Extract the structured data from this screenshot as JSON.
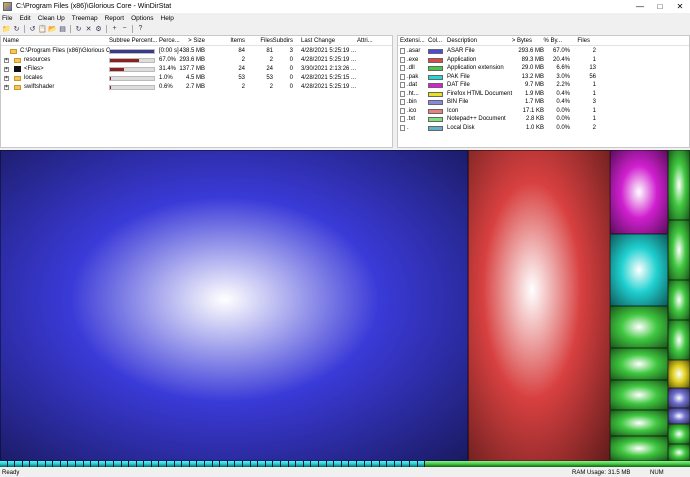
{
  "window": {
    "title": "C:\\Program Files (x86)\\Glorious Core - WinDirStat"
  },
  "menu": [
    "File",
    "Edit",
    "Clean Up",
    "Treemap",
    "Report",
    "Options",
    "Help"
  ],
  "toolbar": [
    "open-folder-icon",
    "refresh-icon",
    "refresh-all-icon",
    "copy-path-icon",
    "open-explorer-icon",
    "open-prompt-icon",
    "refresh-selected-icon",
    "delete-icon",
    "properties-icon",
    "zoom-in-icon",
    "zoom-out-icon",
    "help-icon"
  ],
  "tree": {
    "columns": [
      "Name",
      "Subtree Percent...",
      "Perce...",
      "> Size",
      "Items",
      "Files",
      "Subdirs",
      "Last Change",
      "Attri..."
    ],
    "rows": [
      {
        "name": "C:\\Program Files (x86)\\Glorious C...",
        "kind": "folder",
        "expander": "",
        "subtree_fraction": 1.0,
        "bar_color": "#3a3a8a",
        "percent": "[0:00 s]",
        "size": "438.5 MB",
        "items": "84",
        "files": "81",
        "subdirs": "3",
        "last_change": "4/28/2021 5:25:19 ...",
        "attrib": ""
      },
      {
        "name": "resources",
        "kind": "folder",
        "expander": "+",
        "subtree_fraction": 0.67,
        "bar_color": "#8b2020",
        "percent": "67.0%",
        "size": "293.6 MB",
        "items": "2",
        "files": "2",
        "subdirs": "0",
        "last_change": "4/28/2021 5:25:19 ...",
        "attrib": ""
      },
      {
        "name": "<Files>",
        "kind": "files",
        "expander": "+",
        "subtree_fraction": 0.314,
        "bar_color": "#8b2020",
        "percent": "31.4%",
        "size": "137.7 MB",
        "items": "24",
        "files": "24",
        "subdirs": "0",
        "last_change": "3/30/2021 2:13:26 ...",
        "attrib": ""
      },
      {
        "name": "locales",
        "kind": "folder",
        "expander": "+",
        "subtree_fraction": 0.01,
        "bar_color": "#8b2020",
        "percent": "1.0%",
        "size": "4.5 MB",
        "items": "53",
        "files": "53",
        "subdirs": "0",
        "last_change": "4/28/2021 5:25:15 ...",
        "attrib": ""
      },
      {
        "name": "swiftshader",
        "kind": "folder",
        "expander": "+",
        "subtree_fraction": 0.006,
        "bar_color": "#8b2020",
        "percent": "0.6%",
        "size": "2.7 MB",
        "items": "2",
        "files": "2",
        "subdirs": "0",
        "last_change": "4/28/2021 5:25:19 ...",
        "attrib": ""
      }
    ]
  },
  "extensions": {
    "columns": [
      "Extensi...",
      "Col...",
      "Description",
      "> Bytes",
      "% By...",
      "Files"
    ],
    "rows": [
      {
        "ext": ".asar",
        "color": "#4a4adc",
        "description": "ASAR File",
        "bytes": "293.6 MB",
        "percent": "67.0%",
        "files": "2"
      },
      {
        "ext": ".exe",
        "color": "#e04848",
        "description": "Application",
        "bytes": "89.3 MB",
        "percent": "20.4%",
        "files": "1"
      },
      {
        "ext": ".dll",
        "color": "#48c848",
        "description": "Application extension",
        "bytes": "29.0 MB",
        "percent": "6.6%",
        "files": "13"
      },
      {
        "ext": ".pak",
        "color": "#20d8d8",
        "description": "PAK File",
        "bytes": "13.2 MB",
        "percent": "3.0%",
        "files": "56"
      },
      {
        "ext": ".dat",
        "color": "#d820d8",
        "description": "DAT File",
        "bytes": "9.7 MB",
        "percent": "2.2%",
        "files": "1"
      },
      {
        "ext": ".ht...",
        "color": "#e8e020",
        "description": "Firefox HTML Document",
        "bytes": "1.9 MB",
        "percent": "0.4%",
        "files": "1"
      },
      {
        "ext": ".bin",
        "color": "#8888e0",
        "description": "BIN File",
        "bytes": "1.7 MB",
        "percent": "0.4%",
        "files": "3"
      },
      {
        "ext": ".ico",
        "color": "#e88080",
        "description": "Icon",
        "bytes": "17.1 KB",
        "percent": "0.0%",
        "files": "1"
      },
      {
        "ext": ".txt",
        "color": "#80e080",
        "description": "Notepad++ Document",
        "bytes": "2.8 KB",
        "percent": "0.0%",
        "files": "1"
      },
      {
        "ext": ".",
        "color": "#60b0d0",
        "description": "Local Disk",
        "bytes": "1.0 KB",
        "percent": "0.0%",
        "files": "2"
      }
    ]
  },
  "status": {
    "left": "Ready",
    "ram_label": "RAM Usage:",
    "ram_value": "31.5 MB",
    "num": "NUM"
  },
  "colors": {
    "asar": "#3a3ad8",
    "exe": "#d84040",
    "dll": "#40c840",
    "pak": "#20d0d0",
    "dat": "#d020d0",
    "html": "#e0d020",
    "bin": "#7070d0"
  }
}
